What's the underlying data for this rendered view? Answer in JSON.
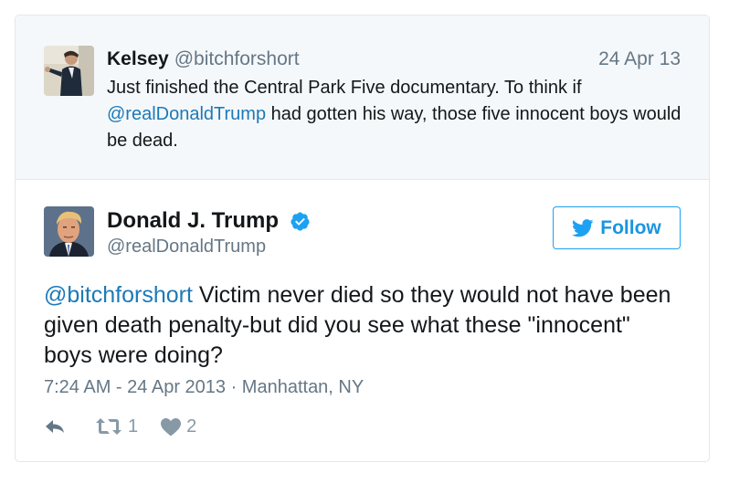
{
  "parent_tweet": {
    "author_name": "Kelsey",
    "author_handle": "@bitchforshort",
    "date": "24 Apr 13",
    "text_before": "Just finished the Central Park Five documentary. To think if ",
    "mention": "@realDonaldTrump",
    "text_after": " had gotten his way, those five innocent boys would be dead."
  },
  "tweet": {
    "author_name": "Donald J. Trump",
    "author_handle": "@realDonaldTrump",
    "verified_icon": "verified-badge-icon",
    "follow_label": "Follow",
    "reply_mention": "@bitchforshort",
    "text": " Victim never died so they would not have been given death penalty-but did you see what these \"innocent\" boys were doing?",
    "meta": "7:24 AM - 24 Apr 2013 · Manhattan, NY",
    "retweet_count": "1",
    "like_count": "2"
  },
  "colors": {
    "link": "#1b7ab8",
    "follow_blue": "#1da1f2",
    "muted": "#657786",
    "parent_bg": "#f5f8fa",
    "border": "#e1e8ed"
  }
}
